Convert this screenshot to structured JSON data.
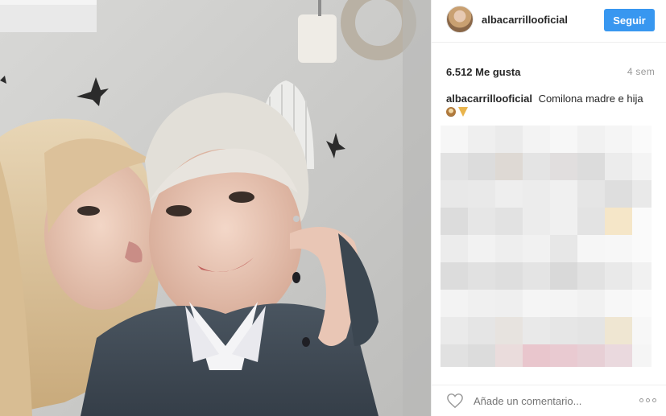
{
  "post": {
    "username": "albacarrillooficial",
    "follow_label": "Seguir",
    "likes": "6.512 Me gusta",
    "time_ago": "4 sem",
    "caption_user": "albacarrillooficial",
    "caption_text": "Comilona madre e hija",
    "caption_emojis": [
      "food-emoji",
      "pizza-emoji"
    ],
    "comment_placeholder": "Añade un comentario...",
    "photo_alt": "Selfie de dos mujeres",
    "colors": {
      "follow_button": "#3897f0",
      "text": "#262626",
      "muted": "#999999"
    },
    "icons": {
      "like": "heart-outline-icon",
      "options": "more-options-icon"
    }
  }
}
